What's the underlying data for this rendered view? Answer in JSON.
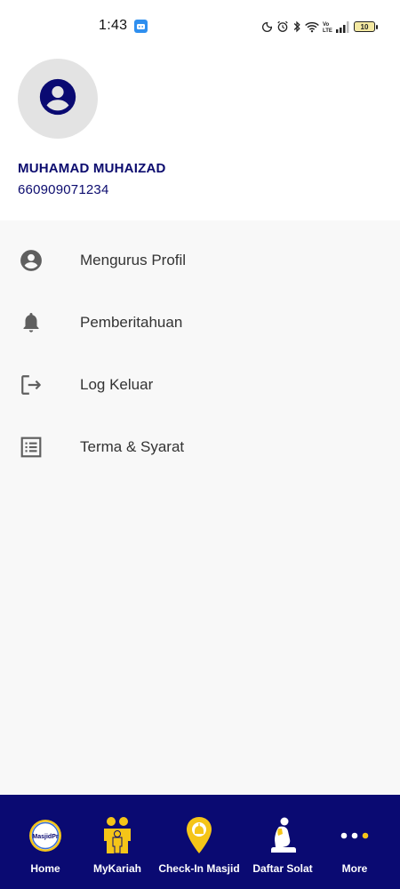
{
  "status_bar": {
    "time": "1:43",
    "battery_level": "10",
    "icons": [
      "moon-icon",
      "alarm-icon",
      "bluetooth-icon",
      "wifi-icon",
      "volte-icon",
      "signal-icon",
      "battery-icon"
    ]
  },
  "profile": {
    "name": "MUHAMAD MUHAIZAD",
    "id_number": "660909071234",
    "avatar_icon": "account-circle-icon"
  },
  "menu": {
    "items": [
      {
        "label": "Mengurus Profil",
        "icon": "account-circle-icon"
      },
      {
        "label": "Pemberitahuan",
        "icon": "bell-icon"
      },
      {
        "label": "Log Keluar",
        "icon": "logout-icon"
      },
      {
        "label": "Terma & Syarat",
        "icon": "list-document-icon"
      }
    ]
  },
  "bottom_nav": {
    "items": [
      {
        "label": "Home",
        "icon": "masjidpro-logo-icon"
      },
      {
        "label": "MyKariah",
        "icon": "family-icon"
      },
      {
        "label": "Check-In Masjid",
        "icon": "mosque-pin-icon"
      },
      {
        "label": "Daftar Solat",
        "icon": "praying-person-icon"
      },
      {
        "label": "More",
        "icon": "more-dots-icon"
      }
    ],
    "logo_text": "MasjidPr"
  },
  "colors": {
    "primary": "#0a0a72",
    "accent": "#f5c518",
    "menu_bg": "#f8f8f8",
    "icon_gray": "#5f5f5f"
  }
}
